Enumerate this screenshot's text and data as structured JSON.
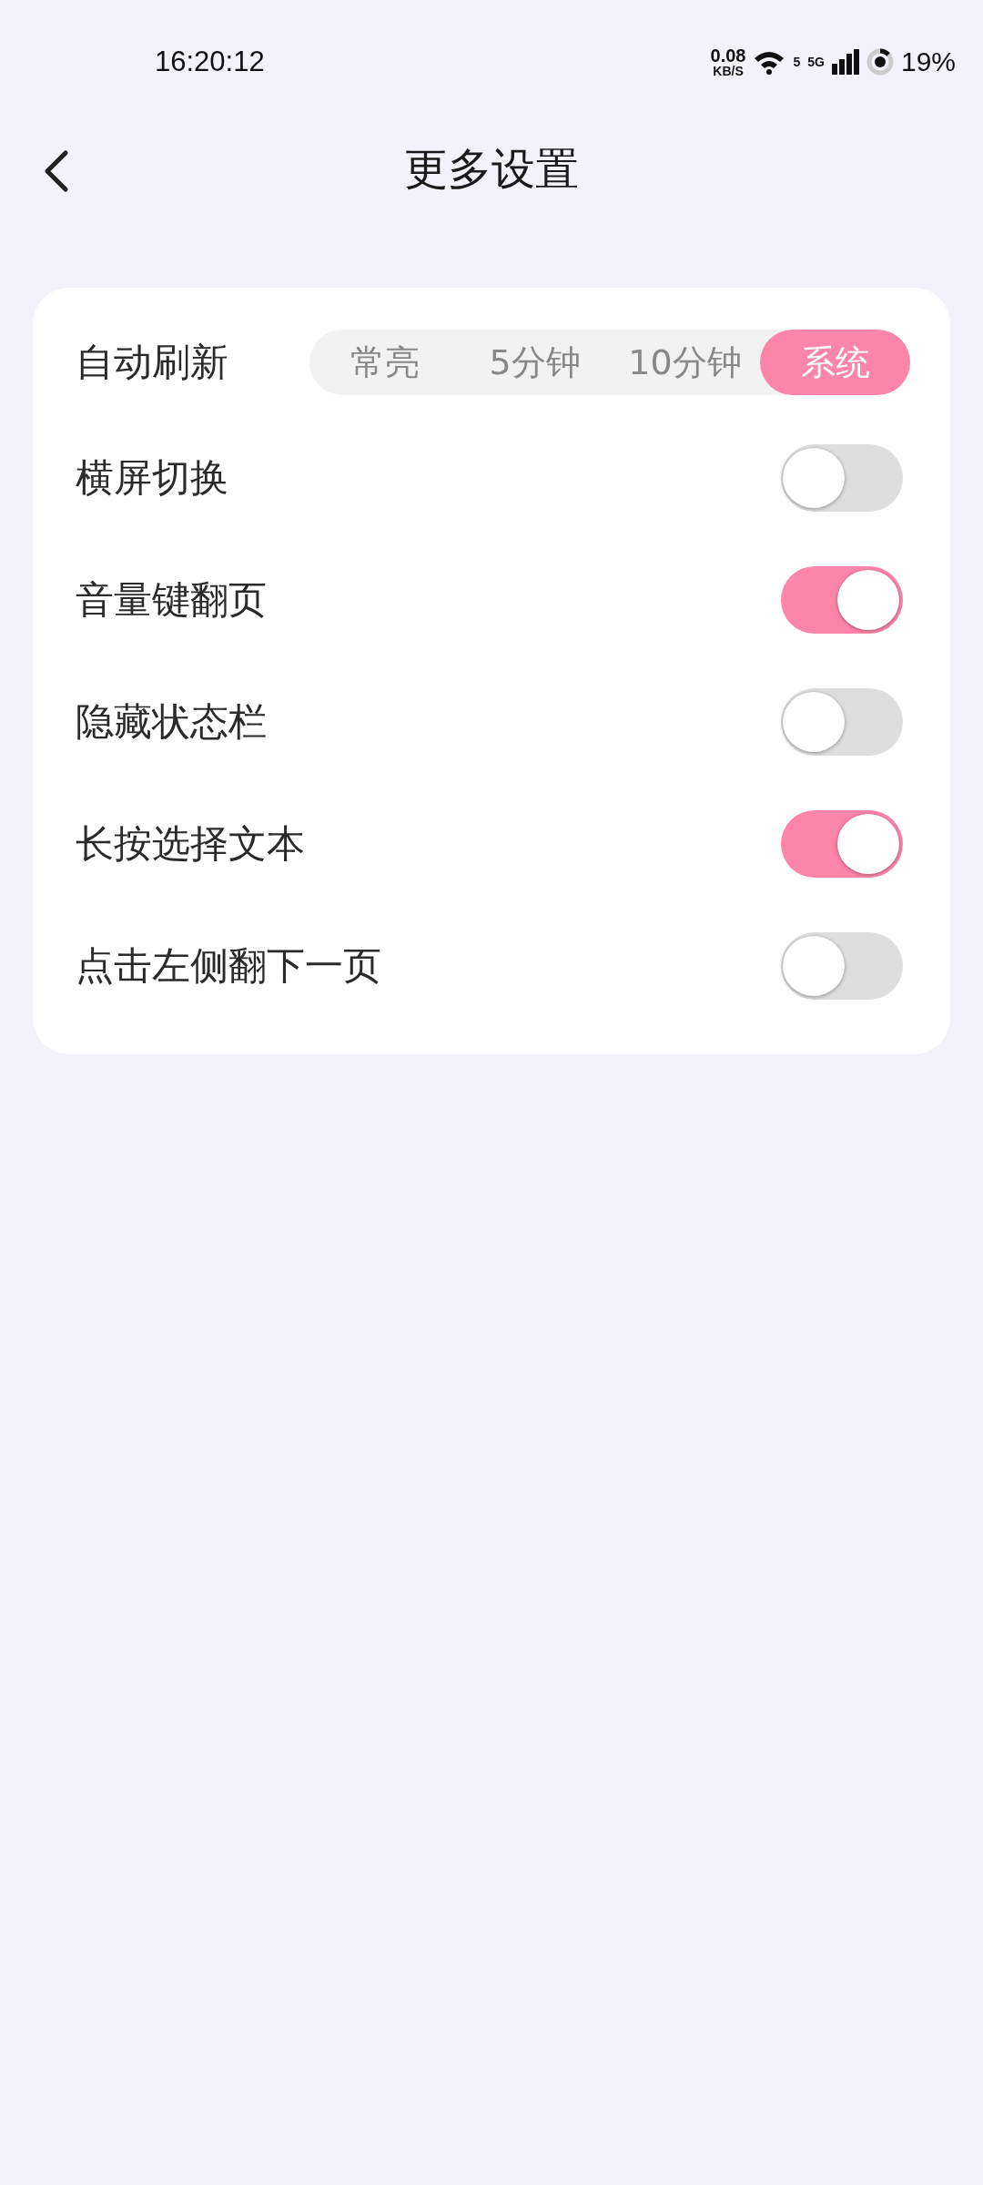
{
  "status_bar": {
    "time": "16:20:12",
    "speed_value": "0.08",
    "speed_unit": "KB/S",
    "wifi_band": "5",
    "network": "5G",
    "battery": "19%"
  },
  "header": {
    "title": "更多设置"
  },
  "settings": [
    {
      "kind": "segmented",
      "label": "自动刷新",
      "options": [
        {
          "label": "常亮",
          "selected": false
        },
        {
          "label": "5分钟",
          "selected": false
        },
        {
          "label": "10分钟",
          "selected": false
        },
        {
          "label": "系统",
          "selected": true
        }
      ]
    },
    {
      "kind": "toggle",
      "label": "横屏切换",
      "on": false
    },
    {
      "kind": "toggle",
      "label": "音量键翻页",
      "on": true
    },
    {
      "kind": "toggle",
      "label": "隐藏状态栏",
      "on": false
    },
    {
      "kind": "toggle",
      "label": "长按选择文本",
      "on": true
    },
    {
      "kind": "toggle",
      "label": "点击左侧翻下一页",
      "on": false
    }
  ]
}
